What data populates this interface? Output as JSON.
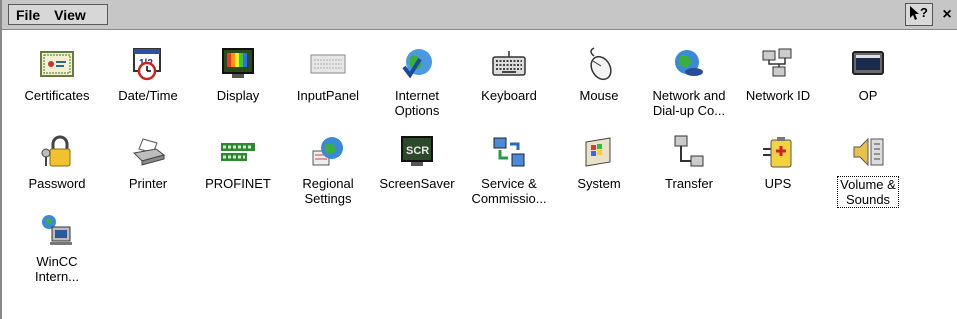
{
  "menubar": {
    "file": "File",
    "view": "View"
  },
  "titlebar": {
    "help_icon": "help-question-icon",
    "close_label": "×"
  },
  "items": [
    {
      "label": "Certificates",
      "icon": "certificate-icon"
    },
    {
      "label": "Date/Time",
      "icon": "calendar-clock-icon"
    },
    {
      "label": "Display",
      "icon": "display-icon"
    },
    {
      "label": "InputPanel",
      "icon": "keyboard-panel-icon"
    },
    {
      "label": "Internet\nOptions",
      "icon": "globe-check-icon"
    },
    {
      "label": "Keyboard",
      "icon": "keyboard-icon"
    },
    {
      "label": "Mouse",
      "icon": "mouse-icon"
    },
    {
      "label": "Network and\nDial-up Co...",
      "icon": "network-globe-icon"
    },
    {
      "label": "Network ID",
      "icon": "network-id-icon"
    },
    {
      "label": "OP",
      "icon": "monitor-icon"
    },
    {
      "label": "Password",
      "icon": "padlock-keys-icon"
    },
    {
      "label": "Printer",
      "icon": "printer-icon"
    },
    {
      "label": "PROFINET",
      "icon": "profinet-icon"
    },
    {
      "label": "Regional\nSettings",
      "icon": "regional-globe-icon"
    },
    {
      "label": "ScreenSaver",
      "icon": "screensaver-icon"
    },
    {
      "label": "Service &\nCommissio...",
      "icon": "service-transfer-icon"
    },
    {
      "label": "System",
      "icon": "system-icon"
    },
    {
      "label": "Transfer",
      "icon": "transfer-icon"
    },
    {
      "label": "UPS",
      "icon": "ups-battery-icon"
    },
    {
      "label": "Volume &\nSounds",
      "icon": "speaker-icon",
      "selected": true
    },
    {
      "label": "WinCC\nIntern...",
      "icon": "wincc-internet-icon"
    }
  ]
}
